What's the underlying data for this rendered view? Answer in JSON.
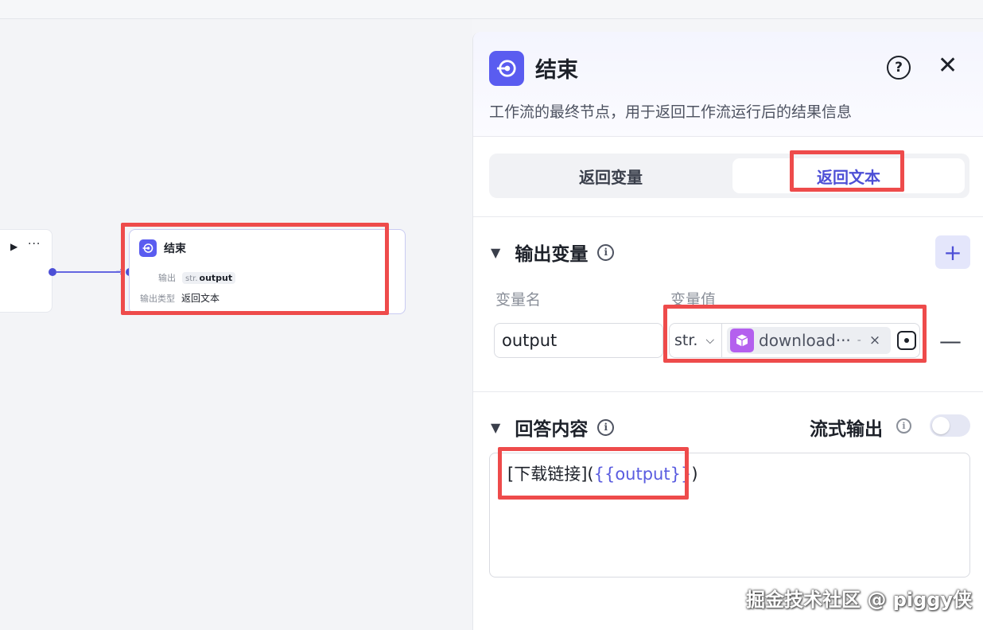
{
  "canvas": {
    "prev_node": {
      "play_icon": "play-icon",
      "more": "···"
    },
    "end_node": {
      "title": "结束",
      "output_label": "输出",
      "output_type_tag": "str.",
      "output_var": "output",
      "output_type_label": "输出类型",
      "output_type_value": "返回文本"
    }
  },
  "panel": {
    "title": "结束",
    "help_icon": "?",
    "close_icon": "✕",
    "description": "工作流的最终节点，用于返回工作流运行后的结果信息",
    "tabs": [
      {
        "label": "返回变量",
        "active": false
      },
      {
        "label": "返回文本",
        "active": true
      }
    ],
    "output_section": {
      "title": "输出变量",
      "col_name": "变量名",
      "col_value": "变量值",
      "add": "+",
      "row": {
        "name": "output",
        "type": "str.",
        "chip_label": "download···",
        "chip_sep": "-",
        "chip_remove": "×",
        "remove": "—"
      }
    },
    "answer_section": {
      "title": "回答内容",
      "stream_label": "流式输出",
      "stream_on": false,
      "text_prefix": "[下载链接](",
      "text_var": "{{output}}",
      "text_suffix": ")"
    }
  },
  "watermark": "掘金技术社区 @ piggy侠",
  "colors": {
    "accent": "#5a5cf0",
    "highlight_box": "#ee4b4b",
    "chip_icon": "#b460ee"
  }
}
